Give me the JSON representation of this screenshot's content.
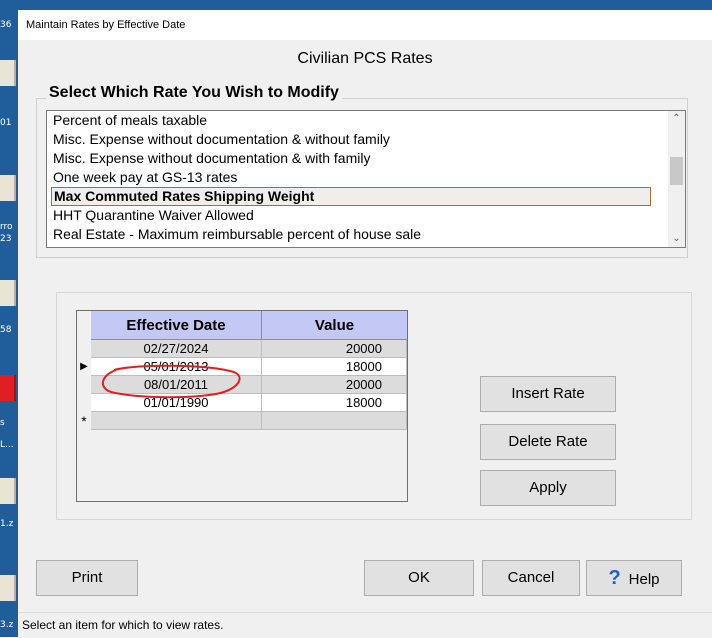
{
  "window": {
    "title": "Maintain Rates by Effective Date"
  },
  "heading": "Civilian PCS Rates",
  "rate_selector": {
    "legend": "Select Which Rate You Wish to Modify",
    "items": [
      "Percent of meals taxable",
      "Misc. Expense without documentation & without family",
      "Misc. Expense without documentation & with family",
      "One week pay at GS-13 rates",
      "Max Commuted Rates Shipping Weight",
      "HHT Quarantine Waiver Allowed",
      "Real Estate - Maximum reimbursable percent of house sale"
    ],
    "selected_index": 4
  },
  "rates_grid": {
    "columns": [
      "Effective Date",
      "Value"
    ],
    "rows": [
      {
        "indicator": "",
        "date": "02/27/2024",
        "value": "20000"
      },
      {
        "indicator": "▶",
        "date": "05/01/2013",
        "value": "18000"
      },
      {
        "indicator": "",
        "date": "08/01/2011",
        "value": "20000"
      },
      {
        "indicator": "",
        "date": "01/01/1990",
        "value": "18000"
      },
      {
        "indicator": "*",
        "date": "",
        "value": ""
      }
    ]
  },
  "buttons": {
    "insert": "Insert Rate",
    "delete": "Delete Rate",
    "apply": "Apply",
    "print": "Print",
    "ok": "OK",
    "cancel": "Cancel",
    "help": "Help"
  },
  "status": "Select an item for which to view rates.",
  "desktop": {
    "labels": [
      "36",
      "01",
      "rro",
      "23",
      "58",
      "s",
      "L...",
      "1.z",
      "3.z"
    ]
  },
  "colors": {
    "grid_header": "#c4c8f4",
    "selection_border": "#b06a2e",
    "annotation_circle": "#e02020"
  }
}
